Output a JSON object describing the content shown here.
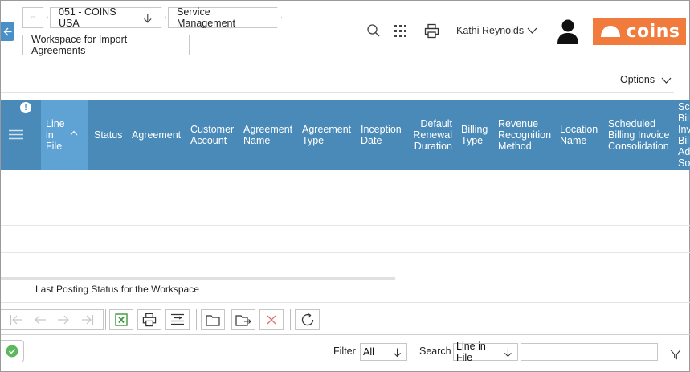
{
  "breadcrumbs": {
    "company": "051 - COINS USA",
    "module": "Service Management",
    "workspace": "Workspace for Import Agreements"
  },
  "header": {
    "user_name": "Kathi Reynolds",
    "logo_text": "coins",
    "options_label": "Options",
    "brand_color": "#f07b3c"
  },
  "grid": {
    "info_badge": "!",
    "columns": [
      {
        "id": "line",
        "lines": [
          "Line",
          "in",
          "File"
        ],
        "sorted": true
      },
      {
        "id": "status",
        "lines": [
          "Status"
        ]
      },
      {
        "id": "agreement",
        "lines": [
          "Agreement"
        ]
      },
      {
        "id": "customer",
        "lines": [
          "Customer",
          "Account"
        ]
      },
      {
        "id": "agname",
        "lines": [
          "Agreement",
          "Name"
        ]
      },
      {
        "id": "agtype",
        "lines": [
          "Agreement",
          "Type"
        ]
      },
      {
        "id": "inception",
        "lines": [
          "Inception",
          "Date"
        ]
      },
      {
        "id": "renewal",
        "lines": [
          "Default",
          "Renewal",
          "Duration"
        ]
      },
      {
        "id": "billing",
        "lines": [
          "Billing",
          "Type"
        ]
      },
      {
        "id": "revenue",
        "lines": [
          "Revenue",
          "Recognition",
          "Method"
        ]
      },
      {
        "id": "location",
        "lines": [
          "Location",
          "Name"
        ]
      },
      {
        "id": "sched",
        "lines": [
          "Scheduled",
          "Billing Invoice",
          "Consolidation"
        ]
      },
      {
        "id": "sched2",
        "lines": [
          "Sch",
          "Bil",
          "Inv",
          "Bil",
          "Ad",
          "So"
        ]
      }
    ],
    "header_color": "#4a8ab8",
    "sorted_color": "#5fa3d4"
  },
  "status_text": "Last Posting Status for the Workspace",
  "footer": {
    "filter_label": "Filter",
    "filter_value": "All",
    "search_label": "Search",
    "search_field_value": "Line in File",
    "search_input_value": ""
  }
}
